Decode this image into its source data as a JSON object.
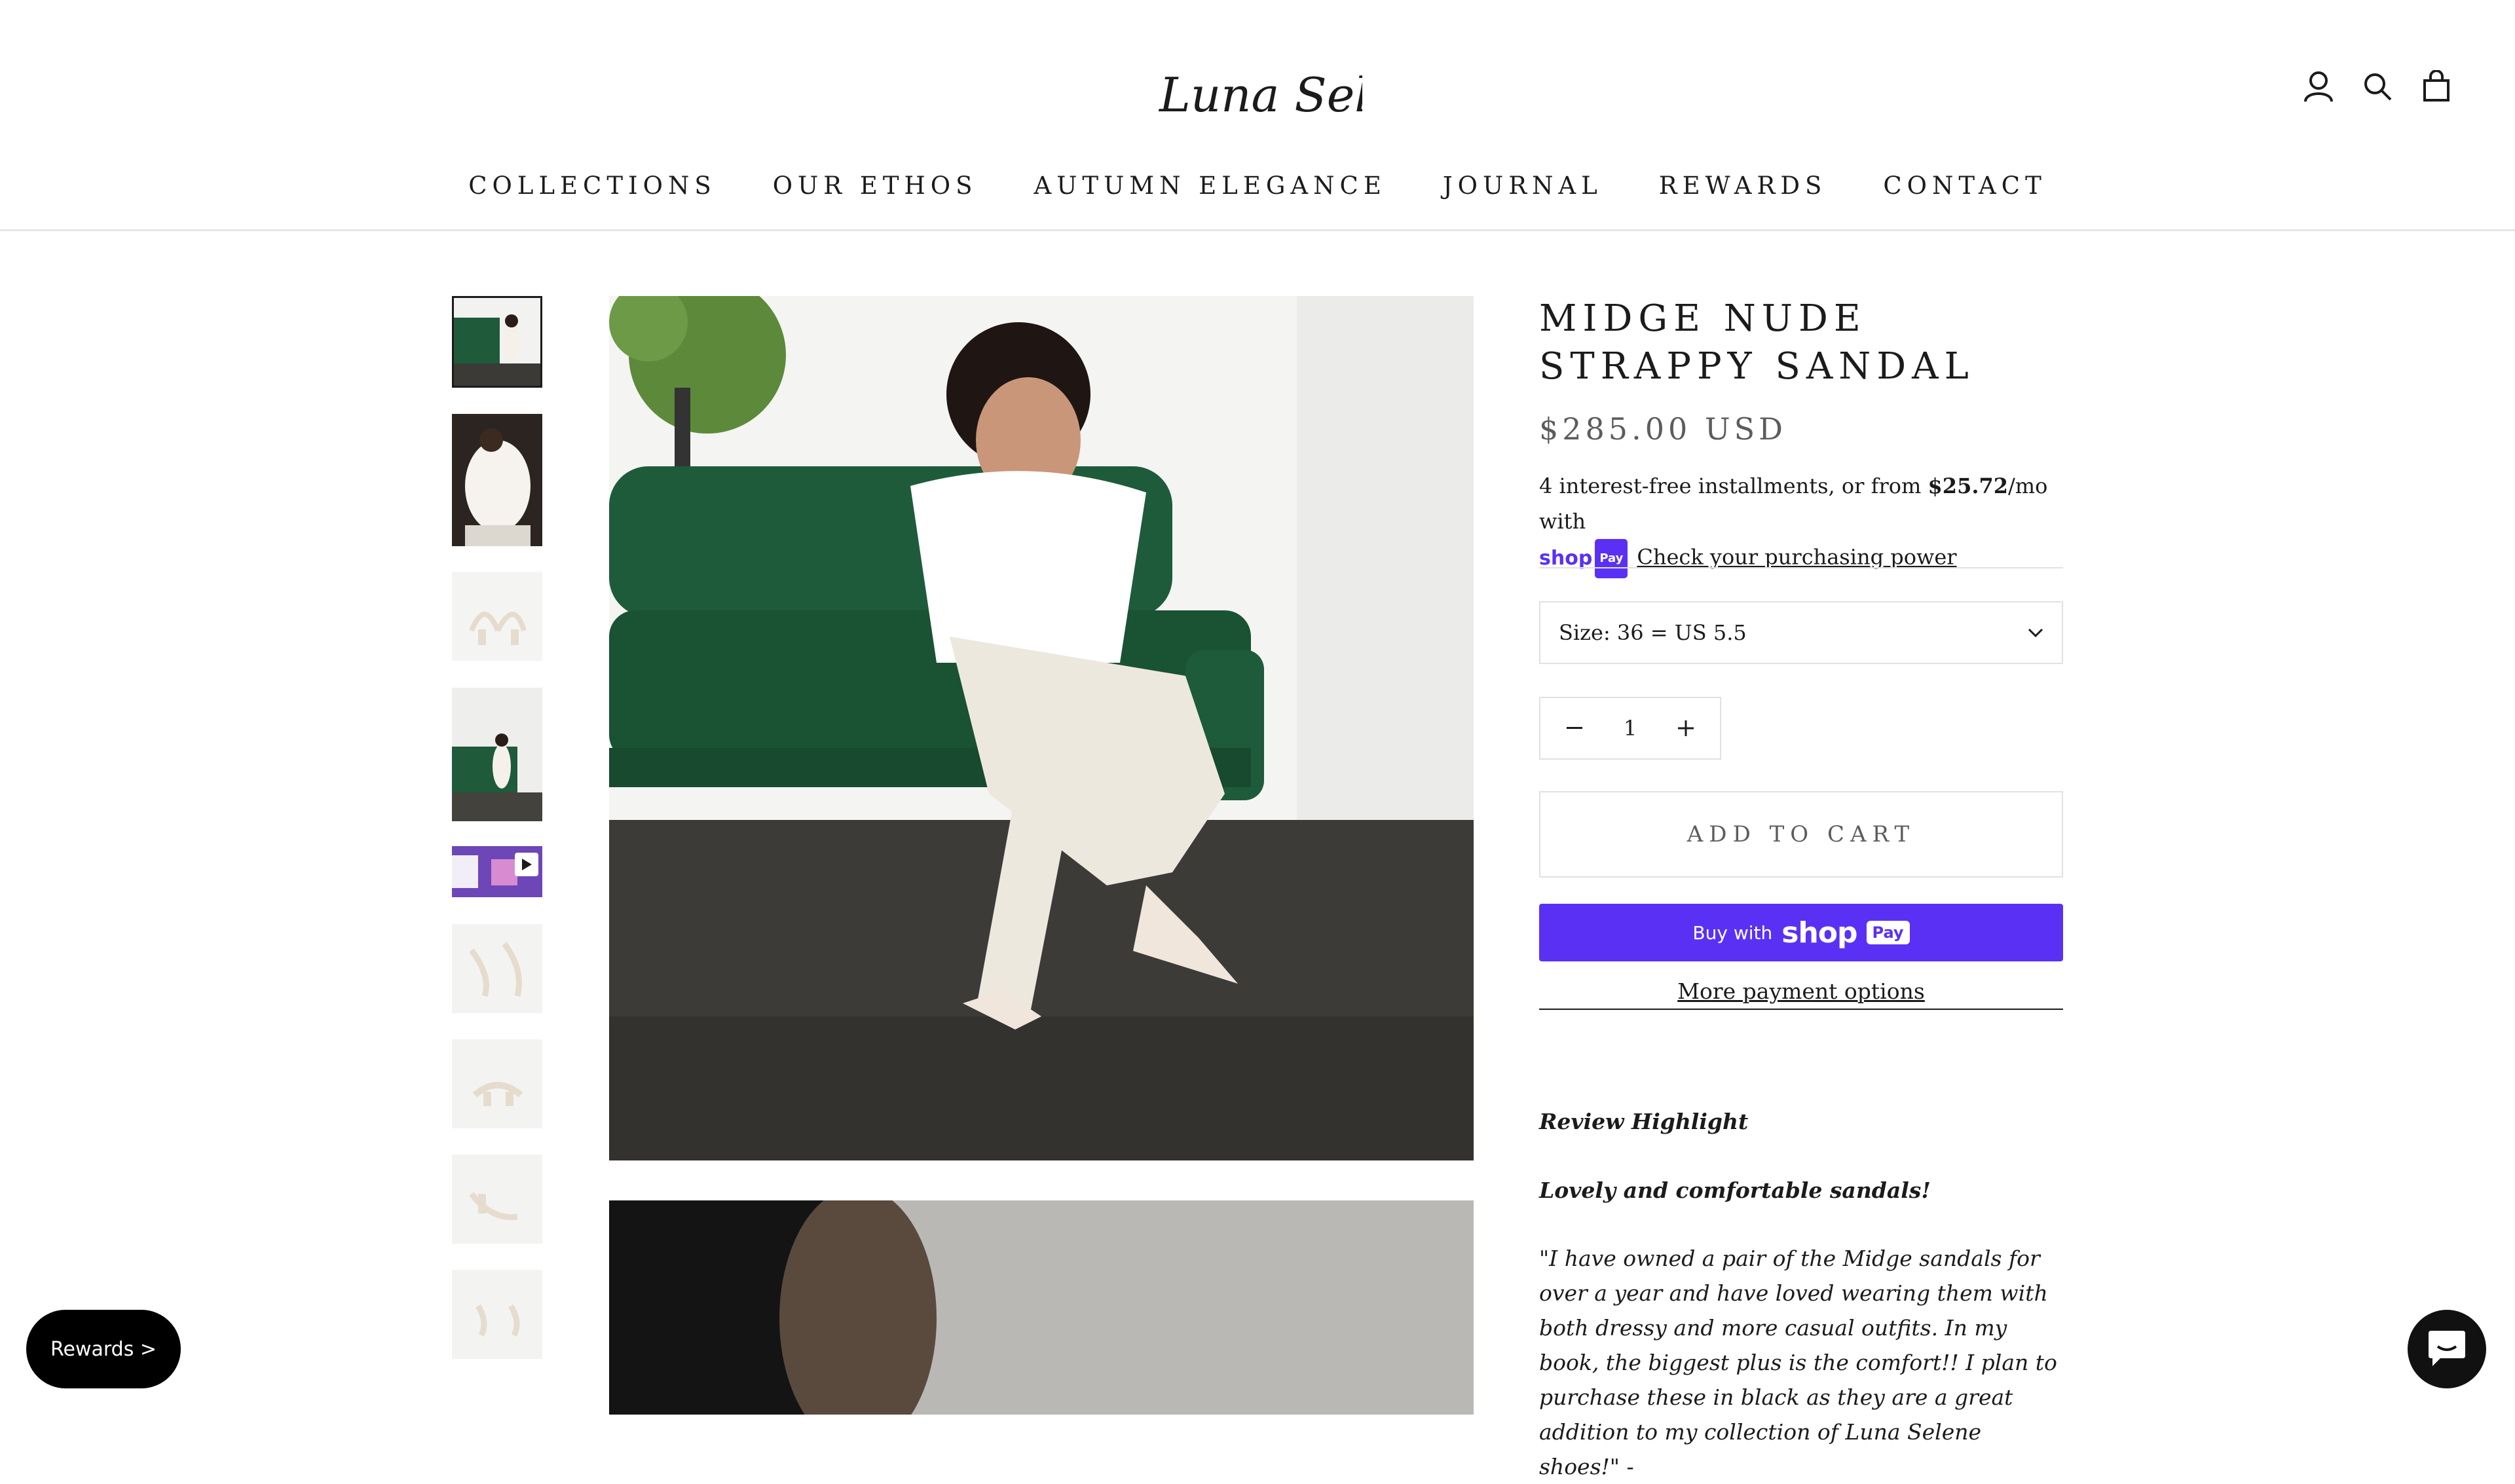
{
  "header": {
    "logo_text": "Luna Selene",
    "nav": [
      "COLLECTIONS",
      "OUR ETHOS",
      "AUTUMN ELEGANCE",
      "JOURNAL",
      "REWARDS",
      "CONTACT"
    ],
    "icons": [
      "account-icon",
      "search-icon",
      "cart-icon"
    ]
  },
  "product": {
    "title": "MIDGE NUDE STRAPPY SANDAL",
    "price": "$285.00 USD",
    "installments": {
      "prefix": "4 interest-free installments, or from ",
      "amount": "$25.72",
      "suffix": "/mo with",
      "shop_word": "shop",
      "pay_word": "Pay",
      "link": "Check your purchasing power"
    },
    "size_select": "Size: 36 = US 5.5",
    "quantity": "1",
    "add_to_cart": "ADD TO CART",
    "buy_with": "Buy with",
    "buy_shop": "shop",
    "buy_pay": "Pay",
    "more_payment": "More payment options"
  },
  "review": {
    "heading": "Review Highlight",
    "title": "Lovely and comfortable sandals!",
    "body": "\"I have owned a pair of the Midge sandals for over a year and have loved wearing them with both dressy and more casual outfits. In my book, the biggest plus is the comfort!! I plan to purchase these in black as they are a great addition to my collection of Luna Selene shoes!\" -"
  },
  "floating": {
    "rewards": "Rewards >"
  },
  "colors": {
    "shop_pay": "#5a31f4",
    "text": "#1c1b1b",
    "muted": "#5c5c5c",
    "border": "#e1e1e1"
  }
}
